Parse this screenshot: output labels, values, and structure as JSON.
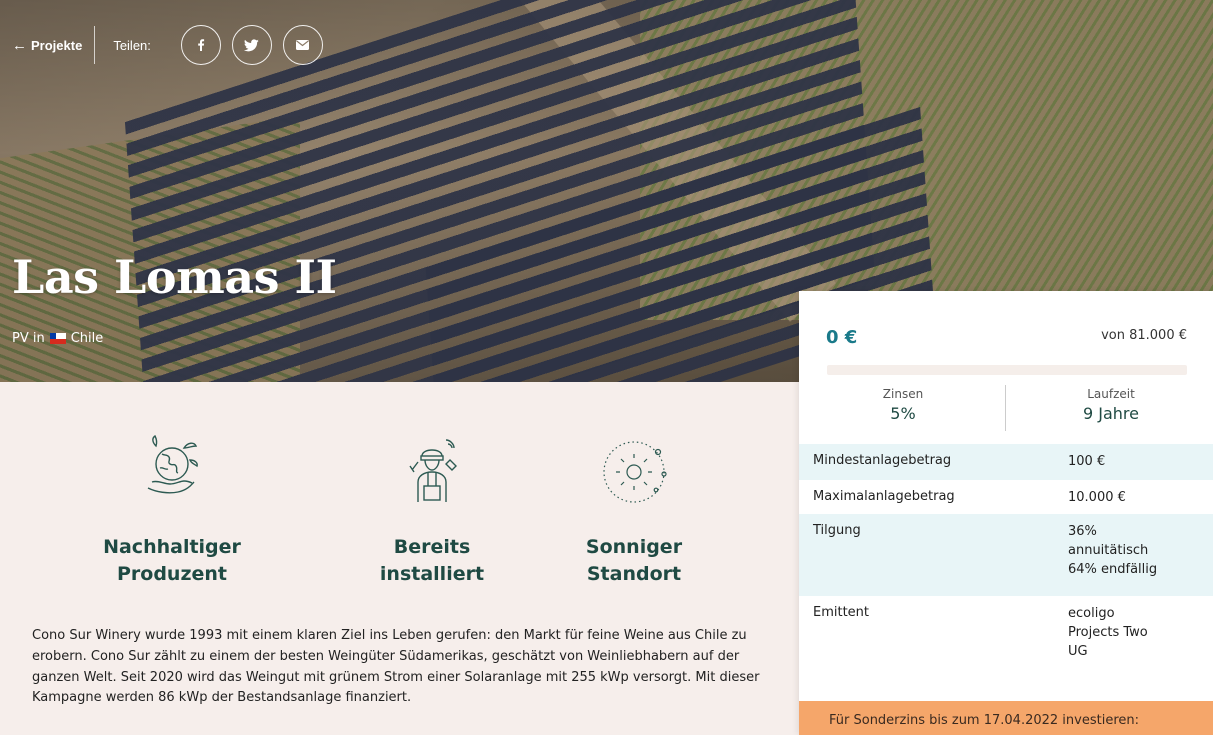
{
  "nav": {
    "back_label": "Projekte",
    "share_label": "Teilen:"
  },
  "share": [
    {
      "name": "facebook",
      "icon": "facebook-icon"
    },
    {
      "name": "twitter",
      "icon": "twitter-icon"
    },
    {
      "name": "email",
      "icon": "mail-icon"
    }
  ],
  "project": {
    "title": "Las Lomas II",
    "type_prefix": "PV in",
    "country": "Chile"
  },
  "features": [
    {
      "label_line1": "Nachhaltiger",
      "label_line2": "Produzent",
      "icon": "globe-hand-icon"
    },
    {
      "label_line1": "Bereits",
      "label_line2": "installiert",
      "icon": "worker-icon"
    },
    {
      "label_line1": "Sonniger",
      "label_line2": "Standort",
      "icon": "sun-icon"
    }
  ],
  "description": "Cono Sur Winery wurde 1993 mit einem klaren Ziel ins Leben gerufen: den Markt für feine Weine aus Chile zu erobern. Cono Sur zählt zu einem der besten Weingüter Südamerikas, geschätzt von Weinliebhabern auf der ganzen Welt. Seit 2020 wird das Weingut mit grünem Strom einer Solaranlage mit 255 kWp versorgt. Mit dieser Kampagne werden 86 kWp der Bestandsanlage finanziert.",
  "investment": {
    "raised": "0 €",
    "target": "von 81.000 €",
    "progress_fraction": 0,
    "interest_label": "Zinsen",
    "interest_value": "5%",
    "term_label": "Laufzeit",
    "term_value": "9 Jahre",
    "min_label": "Mindestanlagebetrag",
    "min_value": "100 €",
    "max_label": "Maximalanlagebetrag",
    "max_value": "10.000 €",
    "repay_label": "Tilgung",
    "repay_line1": "36%",
    "repay_line2": "annuitätisch",
    "repay_line3": "64% endfällig",
    "issuer_label": "Emittent",
    "issuer_line1": "ecoligo",
    "issuer_line2": "Projects Two",
    "issuer_line3": "UG",
    "cta_text": "Für Sonderzins bis zum 17.04.2022 investieren:"
  },
  "colors": {
    "accent": "#1a7a8a",
    "heading": "#1f4a43",
    "background": "#f6eeeb",
    "row_alt": "#e8f5f7",
    "cta": "#f5a66a"
  }
}
